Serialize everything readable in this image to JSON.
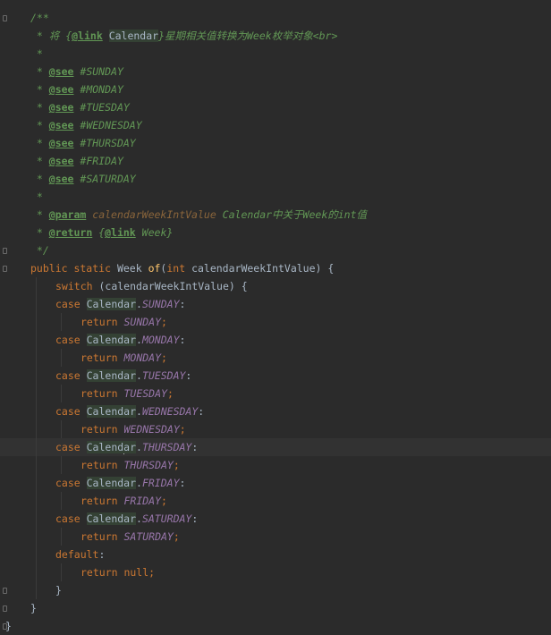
{
  "lines": [
    {
      "indent": 1,
      "fold": true,
      "tokens": [
        {
          "c": "doc",
          "t": "/**"
        }
      ]
    },
    {
      "indent": 1,
      "tokens": [
        {
          "c": "doc",
          "t": " * 将 {"
        },
        {
          "c": "doctag",
          "t": "@link"
        },
        {
          "c": "doc",
          "t": " "
        },
        {
          "c": "docbox",
          "t": "Calendar"
        },
        {
          "c": "doc",
          "t": "}星期相关值转换为Week枚举对象<br>"
        }
      ]
    },
    {
      "indent": 1,
      "tokens": [
        {
          "c": "doc",
          "t": " *"
        }
      ]
    },
    {
      "indent": 1,
      "tokens": [
        {
          "c": "doc",
          "t": " * "
        },
        {
          "c": "doctag",
          "t": "@see"
        },
        {
          "c": "doc",
          "t": " #SUNDAY"
        }
      ]
    },
    {
      "indent": 1,
      "tokens": [
        {
          "c": "doc",
          "t": " * "
        },
        {
          "c": "doctag",
          "t": "@see"
        },
        {
          "c": "doc",
          "t": " #MONDAY"
        }
      ]
    },
    {
      "indent": 1,
      "tokens": [
        {
          "c": "doc",
          "t": " * "
        },
        {
          "c": "doctag",
          "t": "@see"
        },
        {
          "c": "doc",
          "t": " #TUESDAY"
        }
      ]
    },
    {
      "indent": 1,
      "tokens": [
        {
          "c": "doc",
          "t": " * "
        },
        {
          "c": "doctag",
          "t": "@see"
        },
        {
          "c": "doc",
          "t": " #WEDNESDAY"
        }
      ]
    },
    {
      "indent": 1,
      "tokens": [
        {
          "c": "doc",
          "t": " * "
        },
        {
          "c": "doctag",
          "t": "@see"
        },
        {
          "c": "doc",
          "t": " #THURSDAY"
        }
      ]
    },
    {
      "indent": 1,
      "tokens": [
        {
          "c": "doc",
          "t": " * "
        },
        {
          "c": "doctag",
          "t": "@see"
        },
        {
          "c": "doc",
          "t": " #FRIDAY"
        }
      ]
    },
    {
      "indent": 1,
      "tokens": [
        {
          "c": "doc",
          "t": " * "
        },
        {
          "c": "doctag",
          "t": "@see"
        },
        {
          "c": "doc",
          "t": " #SATURDAY"
        }
      ]
    },
    {
      "indent": 1,
      "tokens": [
        {
          "c": "doc",
          "t": " *"
        }
      ]
    },
    {
      "indent": 1,
      "tokens": [
        {
          "c": "doc",
          "t": " * "
        },
        {
          "c": "doctag",
          "t": "@param"
        },
        {
          "c": "doc",
          "t": " "
        },
        {
          "c": "param",
          "t": "calendarWeekIntValue"
        },
        {
          "c": "doc",
          "t": " Calendar中关于Week的int值"
        }
      ]
    },
    {
      "indent": 1,
      "tokens": [
        {
          "c": "doc",
          "t": " * "
        },
        {
          "c": "doctag",
          "t": "@return"
        },
        {
          "c": "doc",
          "t": " {"
        },
        {
          "c": "doctag",
          "t": "@link"
        },
        {
          "c": "doc",
          "t": " "
        },
        {
          "c": "docref",
          "t": "Week"
        },
        {
          "c": "doc",
          "t": "}"
        }
      ]
    },
    {
      "indent": 1,
      "fold": true,
      "tokens": [
        {
          "c": "doc",
          "t": " */"
        }
      ]
    },
    {
      "indent": 1,
      "fold": true,
      "tokens": [
        {
          "c": "kw",
          "t": "public static "
        },
        {
          "c": "plain",
          "t": "Week "
        },
        {
          "c": "meth",
          "t": "of"
        },
        {
          "c": "plain",
          "t": "("
        },
        {
          "c": "kw",
          "t": "int "
        },
        {
          "c": "plain",
          "t": "calendarWeekIntValue) {"
        }
      ]
    },
    {
      "indent": 2,
      "tokens": [
        {
          "c": "kw",
          "t": "switch "
        },
        {
          "c": "plain",
          "t": "(calendarWeekIntValue) {"
        }
      ]
    },
    {
      "indent": 2,
      "tokens": [
        {
          "c": "kw",
          "t": "case "
        },
        {
          "c": "cls-hl",
          "t": "Calendar"
        },
        {
          "c": "plain",
          "t": "."
        },
        {
          "c": "fld",
          "t": "SUNDAY"
        },
        {
          "c": "plain",
          "t": ":"
        }
      ]
    },
    {
      "indent": 3,
      "tokens": [
        {
          "c": "kw",
          "t": "return "
        },
        {
          "c": "fld",
          "t": "SUNDAY"
        },
        {
          "c": "kw",
          "t": ";"
        }
      ]
    },
    {
      "indent": 2,
      "tokens": [
        {
          "c": "kw",
          "t": "case "
        },
        {
          "c": "cls-hl",
          "t": "Calendar"
        },
        {
          "c": "plain",
          "t": "."
        },
        {
          "c": "fld",
          "t": "MONDAY"
        },
        {
          "c": "plain",
          "t": ":"
        }
      ]
    },
    {
      "indent": 3,
      "tokens": [
        {
          "c": "kw",
          "t": "return "
        },
        {
          "c": "fld",
          "t": "MONDAY"
        },
        {
          "c": "kw",
          "t": ";"
        }
      ]
    },
    {
      "indent": 2,
      "tokens": [
        {
          "c": "kw",
          "t": "case "
        },
        {
          "c": "cls-hl",
          "t": "Calendar"
        },
        {
          "c": "plain",
          "t": "."
        },
        {
          "c": "fld",
          "t": "TUESDAY"
        },
        {
          "c": "plain",
          "t": ":"
        }
      ]
    },
    {
      "indent": 3,
      "tokens": [
        {
          "c": "kw",
          "t": "return "
        },
        {
          "c": "fld",
          "t": "TUESDAY"
        },
        {
          "c": "kw",
          "t": ";"
        }
      ]
    },
    {
      "indent": 2,
      "tokens": [
        {
          "c": "kw",
          "t": "case "
        },
        {
          "c": "cls-hl",
          "t": "Calendar"
        },
        {
          "c": "plain",
          "t": "."
        },
        {
          "c": "fld",
          "t": "WEDNESDAY"
        },
        {
          "c": "plain",
          "t": ":"
        }
      ]
    },
    {
      "indent": 3,
      "tokens": [
        {
          "c": "kw",
          "t": "return "
        },
        {
          "c": "fld",
          "t": "WEDNESDAY"
        },
        {
          "c": "kw",
          "t": ";"
        }
      ]
    },
    {
      "indent": 2,
      "current": true,
      "tokens": [
        {
          "c": "kw",
          "t": "case "
        },
        {
          "c": "cls-hl",
          "t": "Calend"
        },
        {
          "c": "caret",
          "t": ""
        },
        {
          "c": "cls-hl",
          "t": "ar"
        },
        {
          "c": "plain",
          "t": "."
        },
        {
          "c": "fld",
          "t": "THURSDAY"
        },
        {
          "c": "plain",
          "t": ":"
        }
      ]
    },
    {
      "indent": 3,
      "tokens": [
        {
          "c": "kw",
          "t": "return "
        },
        {
          "c": "fld",
          "t": "THURSDAY"
        },
        {
          "c": "kw",
          "t": ";"
        }
      ]
    },
    {
      "indent": 2,
      "tokens": [
        {
          "c": "kw",
          "t": "case "
        },
        {
          "c": "cls-hl",
          "t": "Calendar"
        },
        {
          "c": "plain",
          "t": "."
        },
        {
          "c": "fld",
          "t": "FRIDAY"
        },
        {
          "c": "plain",
          "t": ":"
        }
      ]
    },
    {
      "indent": 3,
      "tokens": [
        {
          "c": "kw",
          "t": "return "
        },
        {
          "c": "fld",
          "t": "FRIDAY"
        },
        {
          "c": "kw",
          "t": ";"
        }
      ]
    },
    {
      "indent": 2,
      "tokens": [
        {
          "c": "kw",
          "t": "case "
        },
        {
          "c": "cls-hl",
          "t": "Calendar"
        },
        {
          "c": "plain",
          "t": "."
        },
        {
          "c": "fld",
          "t": "SATURDAY"
        },
        {
          "c": "plain",
          "t": ":"
        }
      ]
    },
    {
      "indent": 3,
      "tokens": [
        {
          "c": "kw",
          "t": "return "
        },
        {
          "c": "fld",
          "t": "SATURDAY"
        },
        {
          "c": "kw",
          "t": ";"
        }
      ]
    },
    {
      "indent": 2,
      "tokens": [
        {
          "c": "kw",
          "t": "default"
        },
        {
          "c": "plain",
          "t": ":"
        }
      ]
    },
    {
      "indent": 3,
      "tokens": [
        {
          "c": "kw",
          "t": "return null;"
        }
      ]
    },
    {
      "indent": 2,
      "fold": true,
      "tokens": [
        {
          "c": "plain",
          "t": "}"
        }
      ]
    },
    {
      "indent": 1,
      "fold": true,
      "tokens": [
        {
          "c": "plain",
          "t": "}"
        }
      ]
    },
    {
      "indent": 0,
      "fold": true,
      "tokens": [
        {
          "c": "plain",
          "t": "}"
        }
      ]
    }
  ],
  "colors": {
    "background": "#2b2b2b",
    "current_line": "#323232",
    "keyword": "#cc7832",
    "javadoc": "#629755",
    "field": "#9876aa",
    "method": "#ffc66d",
    "text": "#a9b7c6",
    "identifier_highlight": "#344134"
  }
}
